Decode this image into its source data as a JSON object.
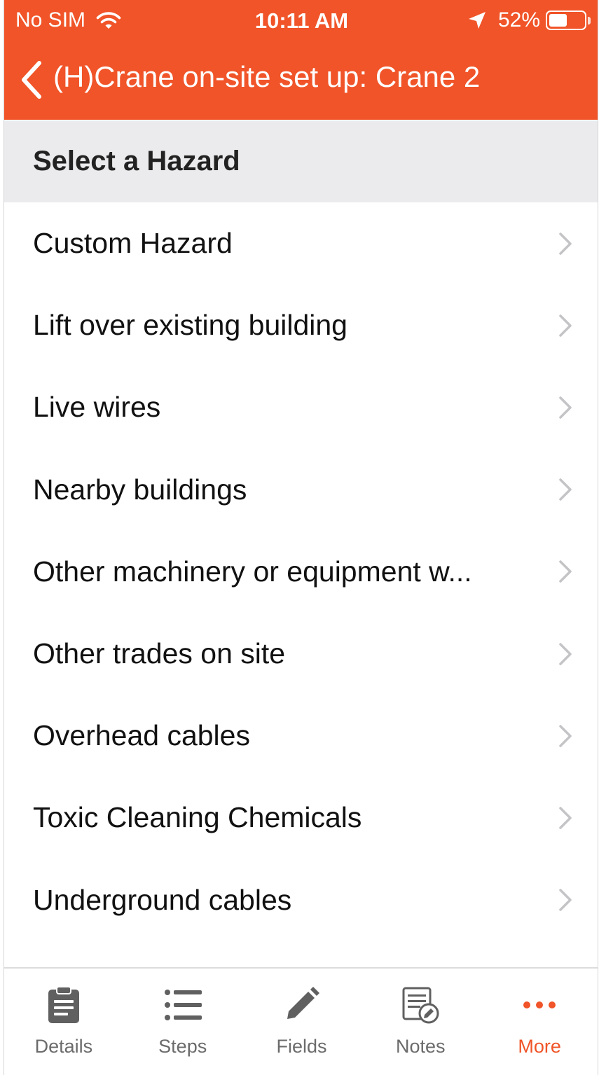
{
  "status_bar": {
    "carrier": "No SIM",
    "time": "10:11 AM",
    "battery": "52%",
    "battery_level": 0.52
  },
  "nav": {
    "title": "(H)Crane on-site set up: Crane 2",
    "back_icon": "chevron-left-icon"
  },
  "section": {
    "title": "Select a Hazard"
  },
  "hazards": [
    {
      "label": "Custom Hazard"
    },
    {
      "label": "Lift over existing building"
    },
    {
      "label": "Live wires"
    },
    {
      "label": "Nearby buildings"
    },
    {
      "label": "Other machinery or equipment w..."
    },
    {
      "label": "Other trades on site"
    },
    {
      "label": "Overhead cables"
    },
    {
      "label": "Toxic Cleaning Chemicals"
    },
    {
      "label": "Underground cables"
    }
  ],
  "tabs": [
    {
      "label": "Details",
      "icon": "clipboard-icon"
    },
    {
      "label": "Steps",
      "icon": "list-icon"
    },
    {
      "label": "Fields",
      "icon": "pencil-icon"
    },
    {
      "label": "Notes",
      "icon": "notes-icon"
    },
    {
      "label": "More",
      "icon": "more-icon",
      "active": true
    }
  ],
  "colors": {
    "accent": "#f05428",
    "section_bg": "#ebebed",
    "tab_inactive": "#6b6b6b"
  }
}
